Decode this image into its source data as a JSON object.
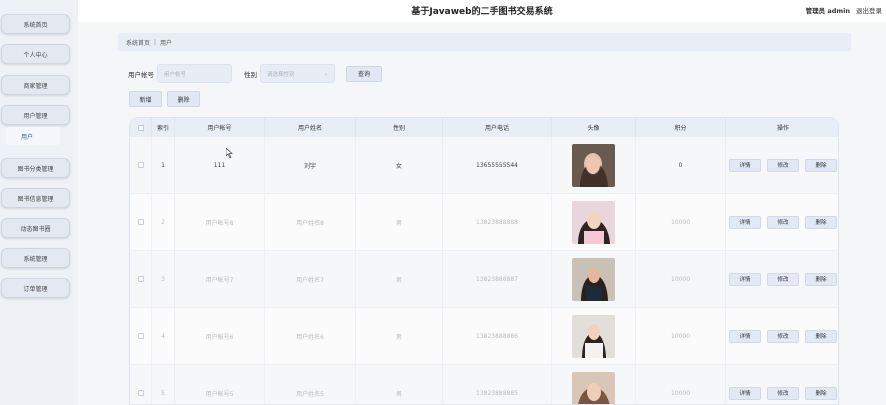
{
  "header": {
    "title": "基于Javaweb的二手图书交易系统",
    "user_label": "管理员 admin",
    "logout": "退出登录"
  },
  "sidebar": {
    "items": [
      {
        "label": "系统首页"
      },
      {
        "label": "个人中心"
      },
      {
        "label": "商家管理"
      },
      {
        "label": "用户管理"
      },
      {
        "label": "图书分类管理"
      },
      {
        "label": "图书信息管理"
      },
      {
        "label": "动态图书圈"
      },
      {
        "label": "系统管理"
      },
      {
        "label": "订单管理"
      }
    ],
    "submenu": {
      "label": "用户"
    }
  },
  "breadcrumb": {
    "home": "系统首页",
    "sep": "|",
    "current": "用户"
  },
  "search": {
    "account_label": "用户帐号",
    "account_placeholder": "用户帐号",
    "gender_label": "性别",
    "gender_placeholder": "请选择性别",
    "search_btn": "查询"
  },
  "actions": {
    "add": "新增",
    "delete": "删除"
  },
  "table": {
    "headers": [
      "索引",
      "用户帐号",
      "用户姓名",
      "性别",
      "用户电话",
      "头像",
      "积分",
      "操作"
    ],
    "rows": [
      {
        "index": "1",
        "account": "111",
        "name": "刘宇",
        "gender": "女",
        "phone": "13655555544",
        "points": "0"
      },
      {
        "index": "2",
        "account": "用户帐号8",
        "name": "用户姓名8",
        "gender": "男",
        "phone": "13823888888",
        "points": "10000"
      },
      {
        "index": "3",
        "account": "用户帐号7",
        "name": "用户姓名7",
        "gender": "男",
        "phone": "13823888887",
        "points": "10000"
      },
      {
        "index": "4",
        "account": "用户帐号6",
        "name": "用户姓名6",
        "gender": "男",
        "phone": "13823888886",
        "points": "10000"
      },
      {
        "index": "5",
        "account": "用户帐号5",
        "name": "用户姓名5",
        "gender": "男",
        "phone": "13823888885",
        "points": "10000"
      }
    ],
    "ops": {
      "detail": "详情",
      "edit": "修改",
      "delete": "删除"
    }
  },
  "colors": {
    "accent": "#e1e8f4",
    "sidebar_bg": "#eef1f6",
    "header_row": "#e8eef8"
  }
}
